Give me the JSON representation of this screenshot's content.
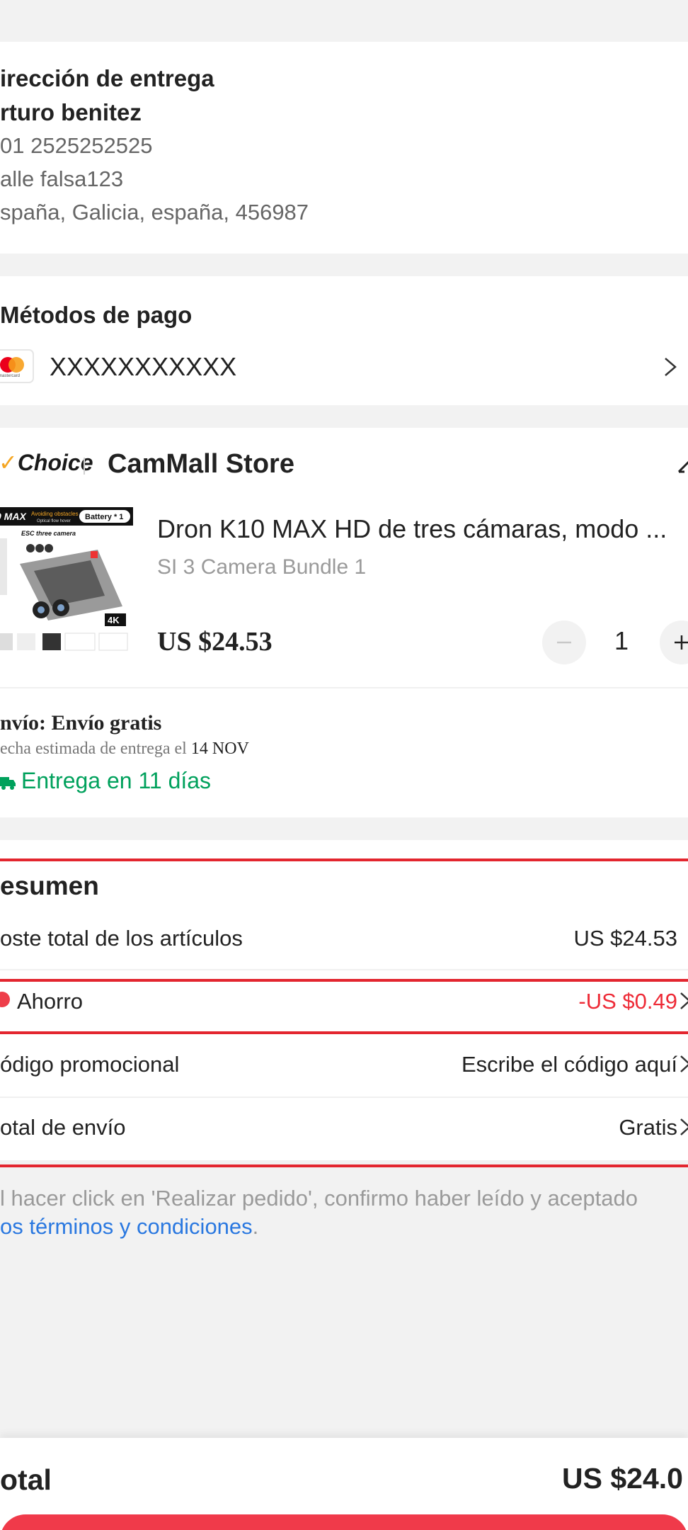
{
  "address": {
    "title": "irección de entrega",
    "name": "rturo benitez",
    "phone": "01 2525252525",
    "street": "alle falsa123",
    "region": "spaña, Galicia, españa, 456987"
  },
  "payment": {
    "title": "Métodos de pago",
    "card_brand": "mastercard",
    "card_number": "XXXXXXXXXXX"
  },
  "store": {
    "badge": "Choice",
    "name": "CamMall Store"
  },
  "product": {
    "title": "Dron K10 MAX HD de tres cámaras, modo ...",
    "variant": "SI 3 Camera Bundle 1",
    "price": "US $24.53",
    "quantity": "1",
    "image_text": {
      "model": "0 MAX",
      "tagline": "Avoiding obstacles",
      "subtag": "Optical flow hover",
      "battery": "Battery * 1",
      "cameras": "ESC three camera",
      "res": "4K"
    }
  },
  "shipping": {
    "title": "nvío: Envío gratis",
    "date_label": "echa estimada de entrega el",
    "date_value": "14 NOV",
    "delivery": "Entrega en 11 días"
  },
  "summary": {
    "title": "esumen",
    "items_total_label": "oste total de los artículos",
    "items_total_value": "US $24.53",
    "savings_label": "Ahorro",
    "savings_value": "-US $0.49",
    "promo_label": "ódigo promocional",
    "promo_value": "Escribe el código aquí",
    "shipping_label": "otal de envío",
    "shipping_value": "Gratis"
  },
  "terms": {
    "text": "l hacer click en 'Realizar pedido', confirmo haber leído y aceptado",
    "link": "os términos y condiciones",
    "period": "."
  },
  "footer": {
    "total_label": "otal",
    "total_value": "US $24.0"
  },
  "colors": {
    "accent_red": "#e3262f",
    "green": "#00a15c",
    "link_blue": "#2a78e0",
    "button_red": "#f03a4a"
  }
}
